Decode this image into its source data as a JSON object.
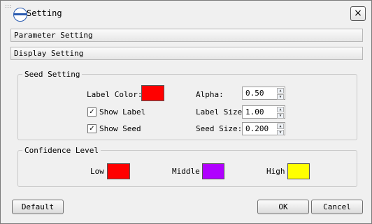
{
  "window": {
    "title": "Setting"
  },
  "sections": {
    "parameter": "Parameter Setting",
    "display": "Display Setting"
  },
  "seed_setting": {
    "title": "Seed Setting",
    "label_color": {
      "label": "Label Color:",
      "color": "#ff0000"
    },
    "show_label": {
      "label": "Show Label",
      "checked": true
    },
    "show_seed": {
      "label": "Show Seed",
      "checked": true
    },
    "alpha": {
      "label": "Alpha:",
      "value": "0.50"
    },
    "label_size": {
      "label": "Label Size",
      "value": "1.00"
    },
    "seed_size": {
      "label": "Seed Size:",
      "value": "0.200"
    }
  },
  "confidence_level": {
    "title": "Confidence Level",
    "low": {
      "label": "Low",
      "color": "#ff0000"
    },
    "middle": {
      "label": "Middle",
      "color": "#b000ff"
    },
    "high": {
      "label": "High",
      "color": "#ffff00"
    }
  },
  "buttons": {
    "default": "Default",
    "ok": "OK",
    "cancel": "Cancel"
  },
  "icons": {
    "close": "close-icon",
    "logo": "app-logo",
    "check": "checkbox-check",
    "up": "spin-up-arrow",
    "down": "spin-down-arrow"
  }
}
